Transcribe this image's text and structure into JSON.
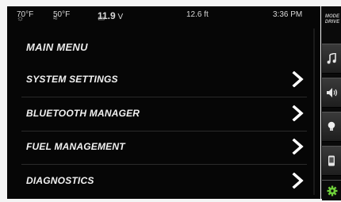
{
  "status_bar": {
    "cabin_temp": "70°F",
    "water_temp": "50°F",
    "battery_voltage": "11.9",
    "battery_unit": "V",
    "depth": "12.6 ft",
    "time": "3:36 PM"
  },
  "main_menu": {
    "title": "MAIN MENU",
    "items": [
      {
        "label": "SYSTEM SETTINGS"
      },
      {
        "label": "BLUETOOTH MANAGER"
      },
      {
        "label": "FUEL MANAGEMENT"
      },
      {
        "label": "DIAGNOSTICS"
      }
    ]
  },
  "side_bar": {
    "mode_label_1": "MODE",
    "mode_label_2": "DRIVE",
    "buttons": [
      {
        "icon": "music-note-icon"
      },
      {
        "icon": "speaker-icon"
      },
      {
        "icon": "light-bulb-icon"
      },
      {
        "icon": "phone-icon"
      },
      {
        "icon": "gear-icon"
      }
    ]
  },
  "colors": {
    "background": "#060606",
    "text": "#f2f2f2",
    "gear_accent": "#6fcf3a"
  }
}
